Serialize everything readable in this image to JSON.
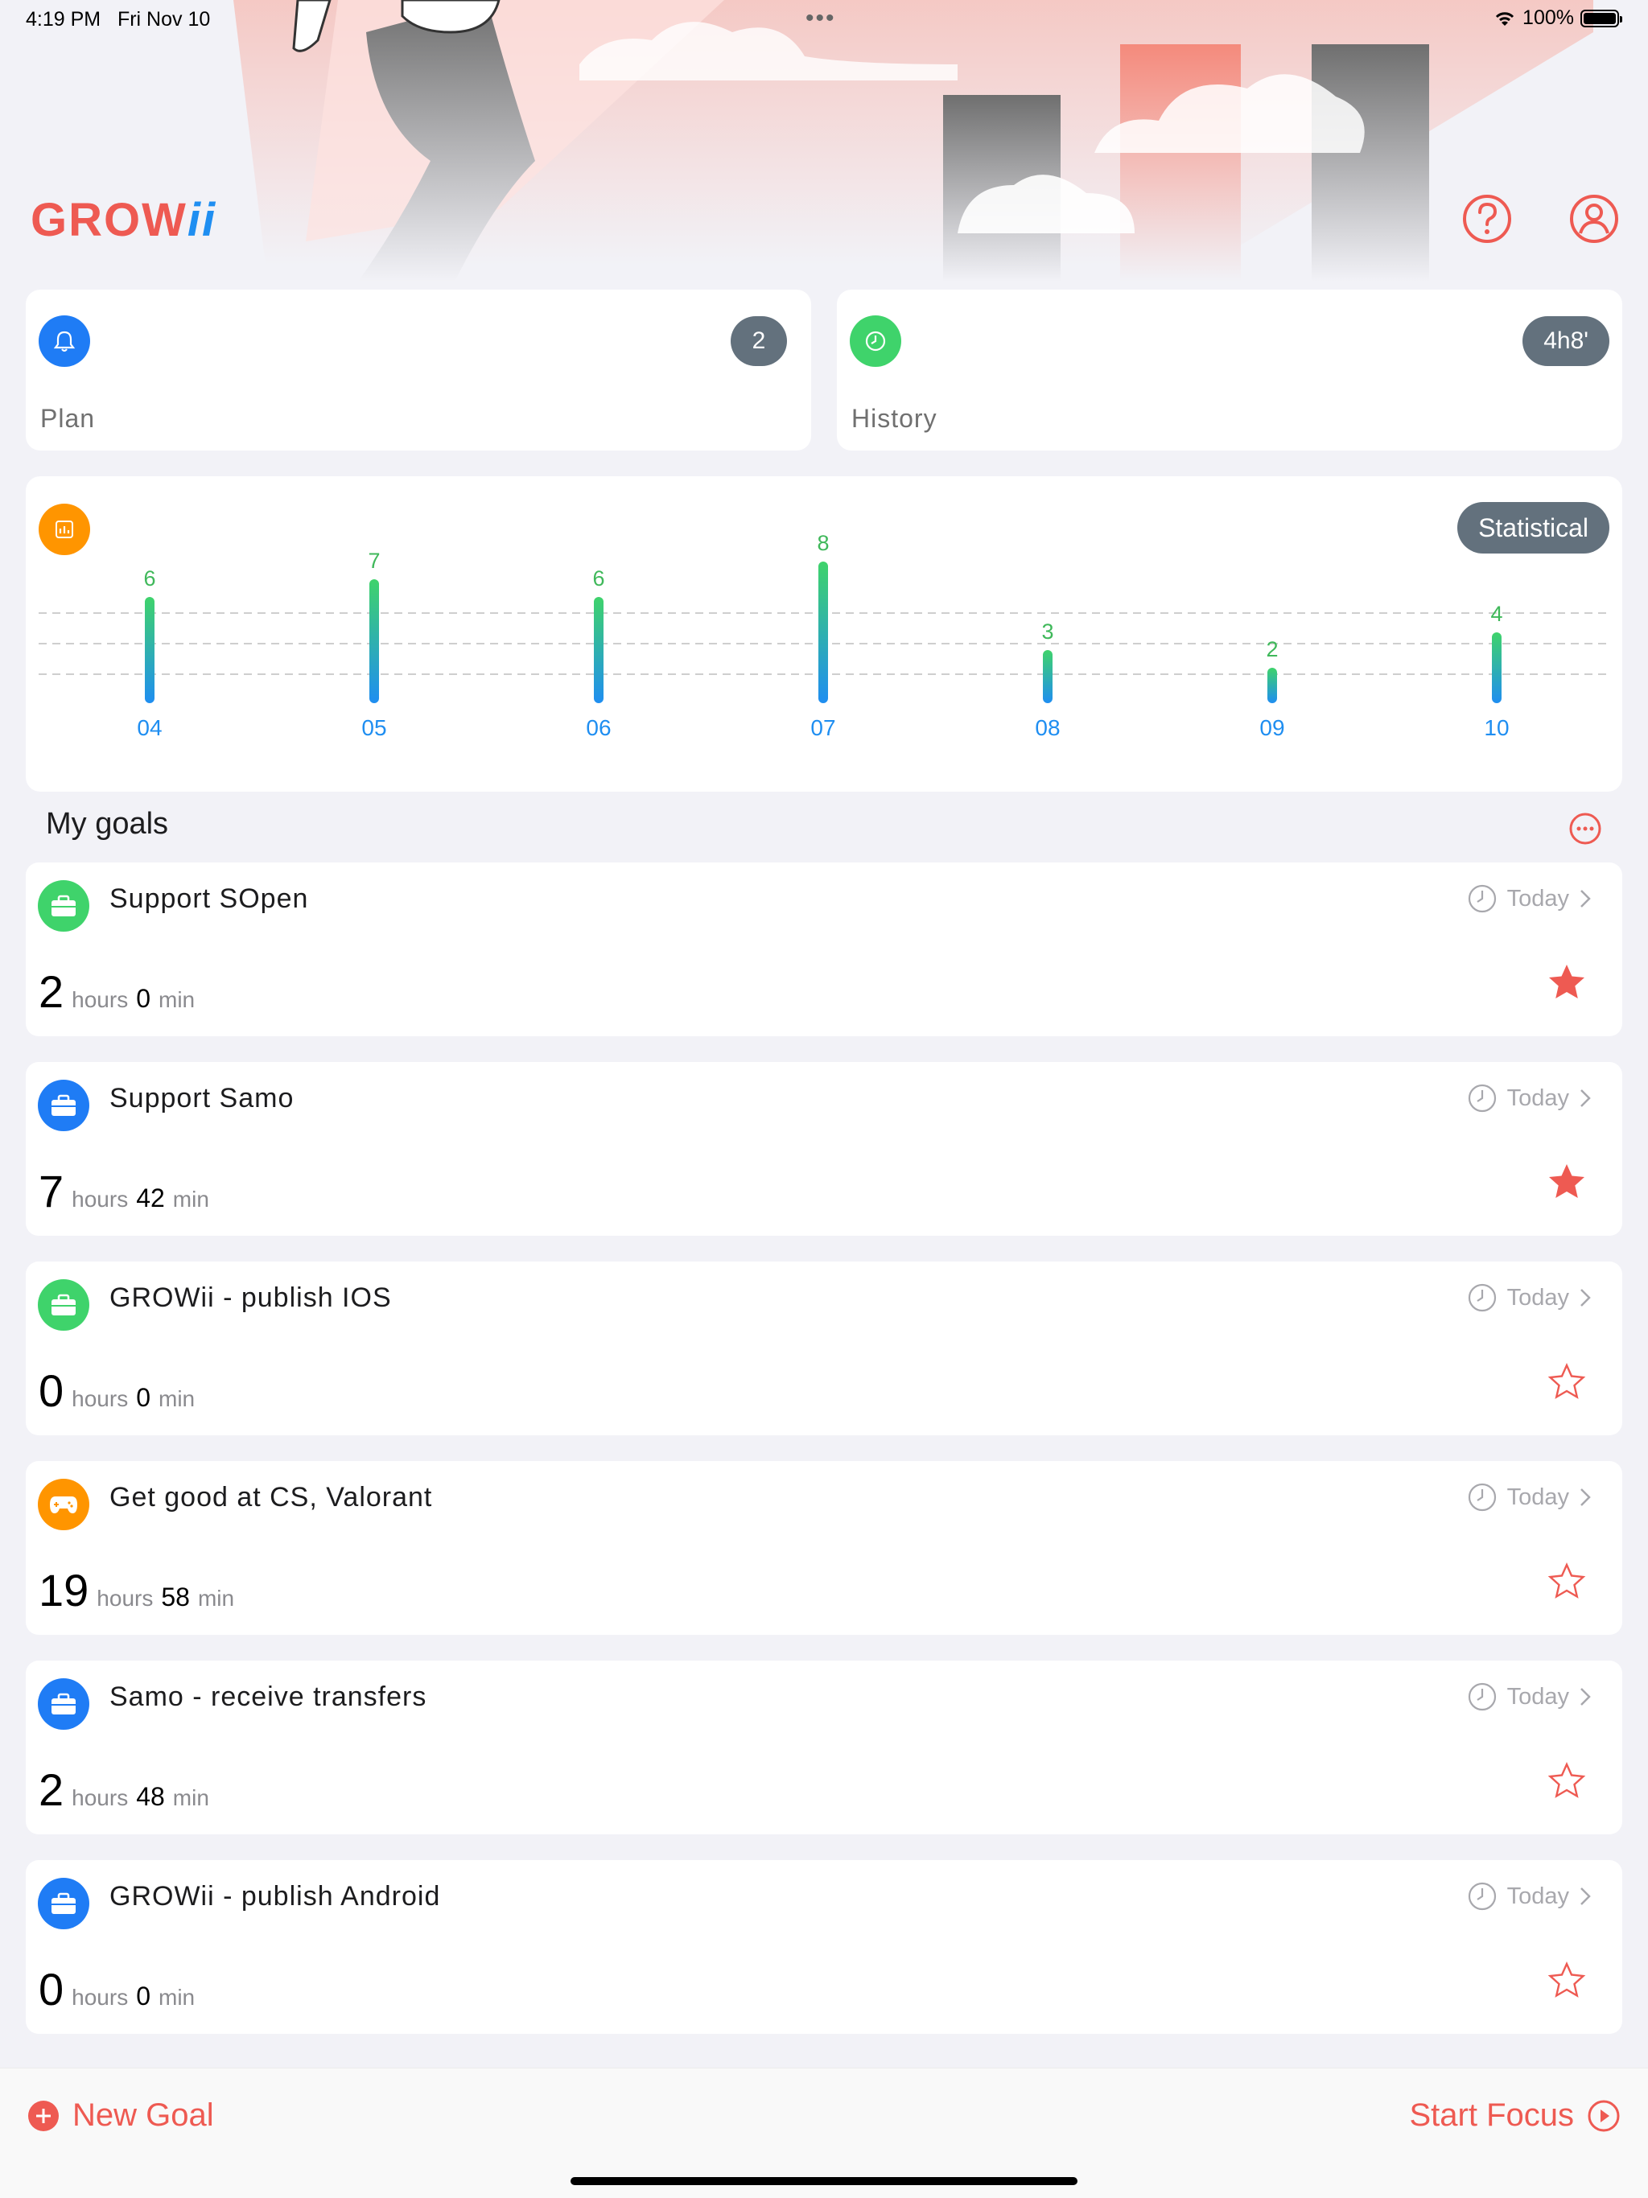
{
  "status_bar": {
    "time": "4:19 PM",
    "date": "Fri Nov 10",
    "battery": "100%"
  },
  "header": {
    "logo_main": "GROW",
    "logo_suffix": "ii",
    "help_icon": "question-icon",
    "profile_icon": "user-icon"
  },
  "summary_cards": {
    "plan": {
      "label": "Plan",
      "badge": "2",
      "icon": "bell-icon",
      "color": "#1f7cf5"
    },
    "history": {
      "label": "History",
      "badge": "4h8'",
      "icon": "clock-icon",
      "color": "#3fd36b"
    }
  },
  "stats_card": {
    "button_label": "Statistical",
    "icon": "chart-icon",
    "color": "#ff9500"
  },
  "chart_data": {
    "type": "bar",
    "categories": [
      "04",
      "05",
      "06",
      "07",
      "08",
      "09",
      "10"
    ],
    "values": [
      6,
      7,
      6,
      8,
      3,
      2,
      4
    ],
    "title": "",
    "xlabel": "",
    "ylabel": "",
    "ylim": [
      0,
      8
    ],
    "grid": true
  },
  "goals_section": {
    "title": "My goals",
    "more_icon": "more-icon"
  },
  "goals": [
    {
      "title": "Support SOpen",
      "hours": "2",
      "minutes": "0",
      "hours_unit": "hours",
      "min_unit": "min",
      "when": "Today",
      "starred": true,
      "icon": "briefcase-icon",
      "color": "#3fd36b"
    },
    {
      "title": "Support Samo",
      "hours": "7",
      "minutes": "42",
      "hours_unit": "hours",
      "min_unit": "min",
      "when": "Today",
      "starred": true,
      "icon": "briefcase-icon",
      "color": "#1f7cf5"
    },
    {
      "title": "GROWii - publish IOS",
      "hours": "0",
      "minutes": "0",
      "hours_unit": "hours",
      "min_unit": "min",
      "when": "Today",
      "starred": false,
      "icon": "briefcase-icon",
      "color": "#3fd36b"
    },
    {
      "title": "Get good at CS, Valorant",
      "hours": "19",
      "minutes": "58",
      "hours_unit": "hours",
      "min_unit": "min",
      "when": "Today",
      "starred": false,
      "icon": "gamepad-icon",
      "color": "#ff9500"
    },
    {
      "title": "Samo - receive transfers",
      "hours": "2",
      "minutes": "48",
      "hours_unit": "hours",
      "min_unit": "min",
      "when": "Today",
      "starred": false,
      "icon": "briefcase-icon",
      "color": "#1f7cf5"
    },
    {
      "title": "GROWii - publish Android",
      "hours": "0",
      "minutes": "0",
      "hours_unit": "hours",
      "min_unit": "min",
      "when": "Today",
      "starred": false,
      "icon": "briefcase-icon",
      "color": "#1f7cf5"
    }
  ],
  "bottom_bar": {
    "new_goal": "New Goal",
    "start_focus": "Start Focus"
  },
  "colors": {
    "accent": "#ee5a52",
    "bar_top": "#3fd36b",
    "bar_bottom": "#1f8ef1",
    "pill": "#63717d"
  }
}
